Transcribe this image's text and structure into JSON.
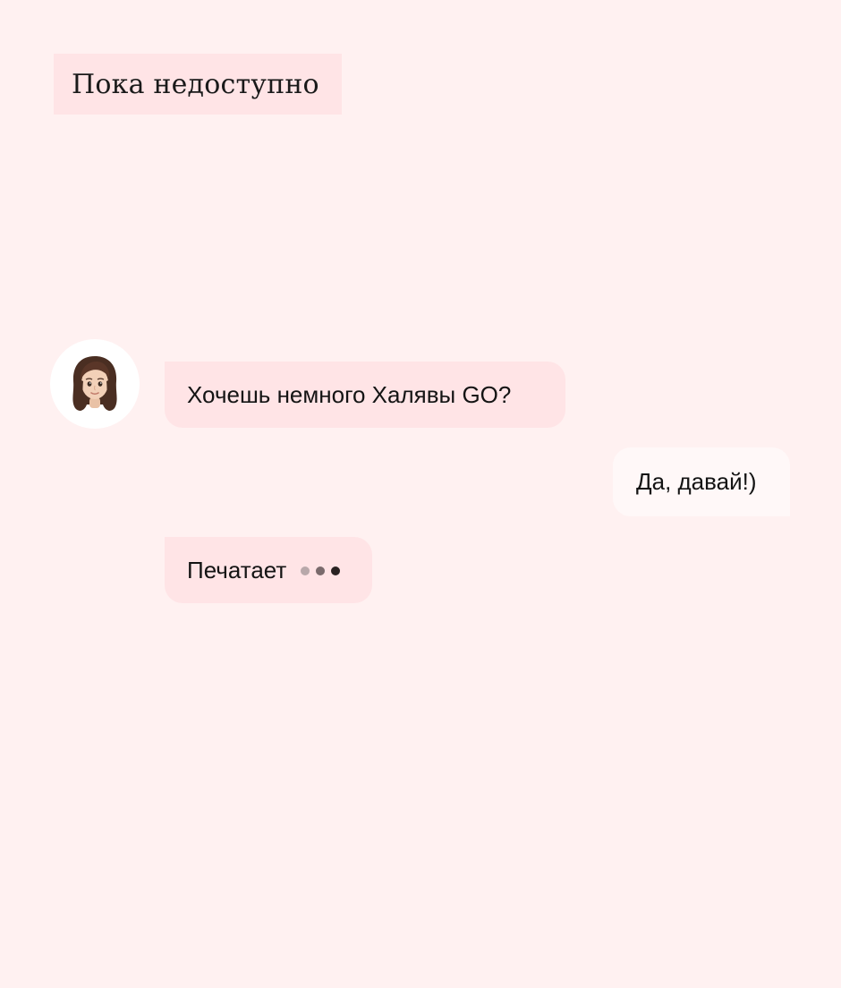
{
  "status": {
    "label": "Пока недоступно"
  },
  "chat": {
    "avatar_icon": "memoji-woman-icon",
    "messages": [
      {
        "from": "bot",
        "text": "Хочешь немного Халявы GO?"
      },
      {
        "from": "user",
        "text": "Да, давай!)"
      }
    ],
    "typing": {
      "label": "Печатает",
      "dot_colors": [
        "#b8a8aa",
        "#7a6a6c",
        "#2a2222"
      ]
    }
  },
  "colors": {
    "background": "#fff1f1",
    "incoming_bubble": "#ffe4e6",
    "outgoing_bubble": "#fff8f8",
    "badge": "#ffe4e6"
  }
}
